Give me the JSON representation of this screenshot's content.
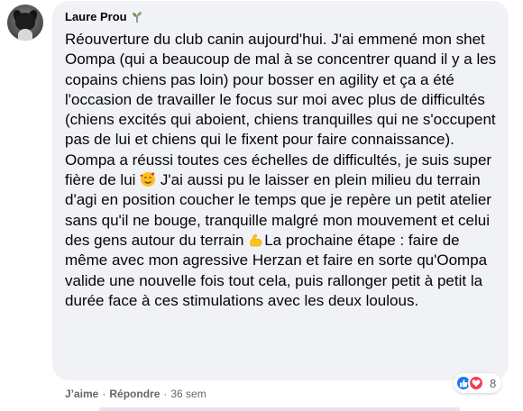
{
  "comment": {
    "author": "Laure Prou",
    "author_badge_icon": "sprout-icon",
    "segments": [
      "Réouverture du club canin aujourd'hui. J'ai emmené mon shet Oompa (qui a beaucoup de mal à se concentrer quand il y a les copains chiens pas loin) pour bosser en agility et ça a été l'occasion de travailler le focus sur moi avec plus de difficultés (chiens excités qui aboient, chiens tranquilles qui ne s'occupent pas de lui et chiens qui le fixent pour faire connaissance). Oompa a réussi toutes ces échelles de difficultés, je suis super fière de lui ",
      " J'ai aussi pu le laisser en plein milieu du terrain d'agi en position coucher le temps que je repère un petit atelier sans qu'il ne bouge, tranquille malgré mon mouvement et celui des gens autour du terrain ",
      "La prochaine étape : faire de même avec mon agressive Herzan et faire en sorte qu'Oompa valide une nouvelle fois tout cela, puis rallonger petit à petit la durée face à ces stimulations avec les deux loulous."
    ],
    "emoji_1": "smiling-face-with-hearts-emoji",
    "emoji_2": "flexed-biceps-emoji"
  },
  "reactions": {
    "types": [
      "like-icon",
      "love-icon"
    ],
    "count": "8"
  },
  "actions": {
    "like_label": "J’aime",
    "reply_label": "Répondre",
    "separator": "·",
    "timestamp": "36 sem"
  },
  "colors": {
    "bubble_bg": "#f0f2f5",
    "text": "#050505",
    "meta": "#65676b",
    "like_blue": "#1877f2",
    "love_red": "#f33e58"
  }
}
